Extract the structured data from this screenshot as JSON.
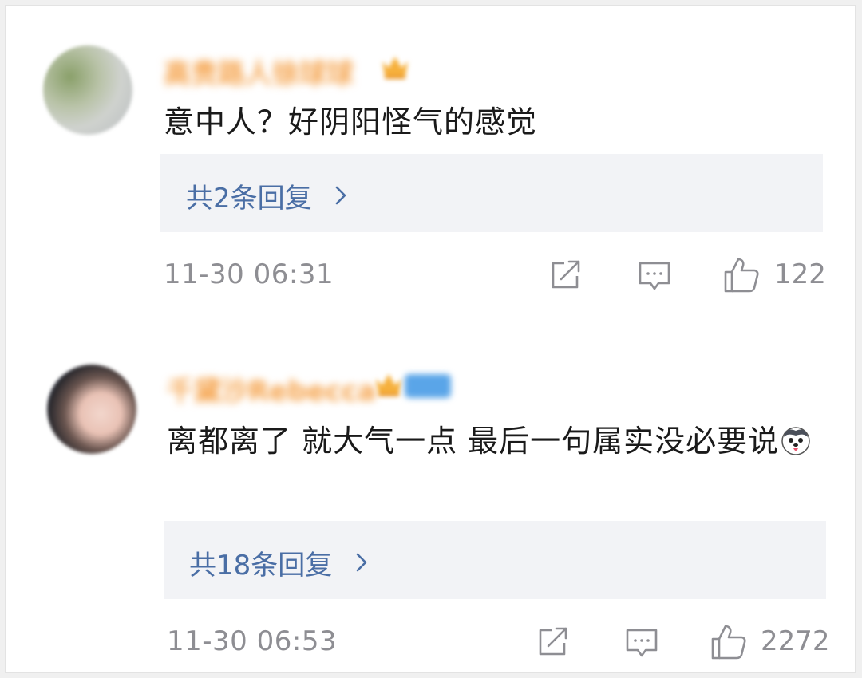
{
  "comments": [
    {
      "username": "高贵路人徐球球",
      "text": "意中人？好阴阳怪气的感觉",
      "replies_label": "共2条回复",
      "timestamp": "11-30 06:31",
      "likes": "122"
    },
    {
      "username": "千黛沙Rebecca",
      "text": "离都离了 就大气一点 最后一句属实没必要说",
      "replies_label": "共18条回复",
      "timestamp": "11-30 06:53",
      "likes": "2272"
    }
  ],
  "icons": {
    "share": "share-icon",
    "comment": "comment-icon",
    "like": "thumbs-up-icon",
    "chevron": "chevron-right-icon",
    "vip": "crown-icon",
    "emoji": "husky-emoji"
  },
  "colors": {
    "username": "#f5a24a",
    "link": "#4a6ea5",
    "meta": "#8e8e93",
    "reply_bg": "#f2f3f6"
  }
}
